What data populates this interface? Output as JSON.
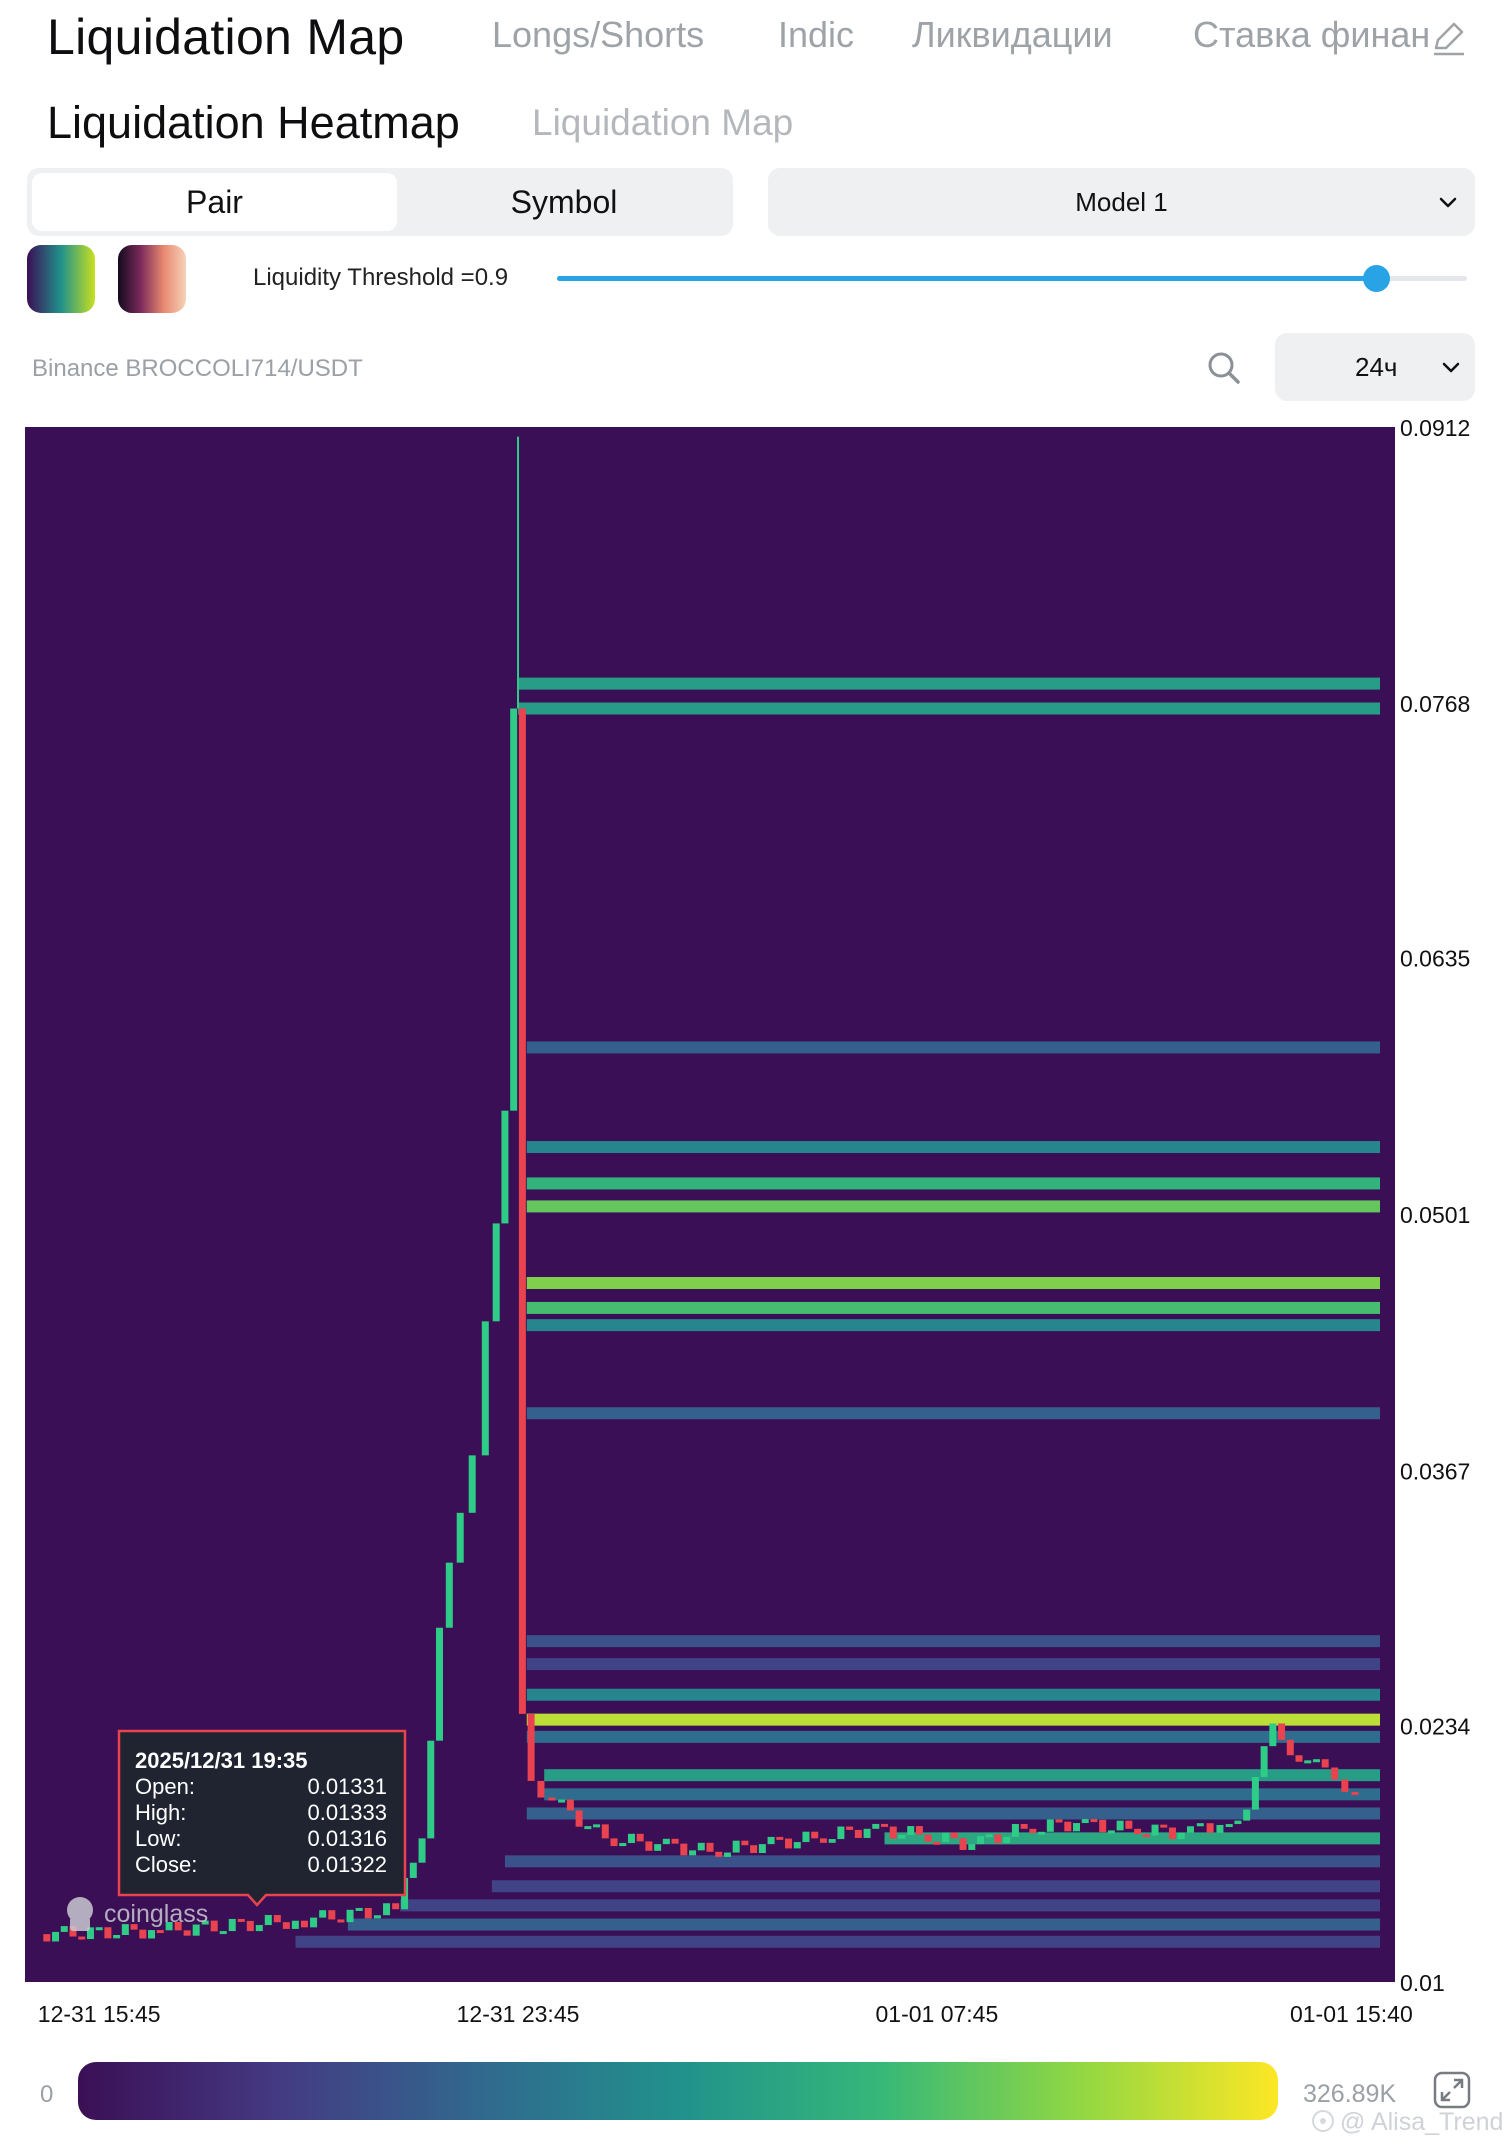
{
  "nav": {
    "title": "Liquidation Map",
    "tabs": [
      "Longs/Shorts",
      "Indic",
      "Ликвидации",
      "Ставка финан"
    ]
  },
  "sub": {
    "title": "Liquidation Heatmap",
    "tab": "Liquidation Map"
  },
  "segment": {
    "options": [
      "Pair",
      "Symbol"
    ],
    "active": "Pair"
  },
  "model": {
    "selected": "Model 1"
  },
  "threshold": {
    "label": "Liquidity Threshold =0.9",
    "value": 0.9
  },
  "pair_label": "Binance BROCCOLI714/USDT",
  "timeframe": {
    "selected": "24ч"
  },
  "tooltip": {
    "date": "2025/12/31 19:35",
    "rows": [
      {
        "label": "Open:",
        "value": "0.01331"
      },
      {
        "label": "High:",
        "value": "0.01333"
      },
      {
        "label": "Low:",
        "value": "0.01316"
      },
      {
        "label": "Close:",
        "value": "0.01322"
      }
    ]
  },
  "watermark": "coinglass",
  "legend": {
    "min": "0",
    "max": "326.89K"
  },
  "credit": "@ Alisa_Trend",
  "colors": {
    "background": "#3b0f55",
    "up": "#2ecc87",
    "down": "#e8434f",
    "accent": "#27a3e6"
  },
  "icons": [
    "edit-icon",
    "chevron-down-icon",
    "search-icon",
    "fullscreen-icon",
    "coinglass-logo-icon"
  ],
  "chart_data": {
    "type": "heatmap",
    "title": "",
    "xlabel": "",
    "ylabel": "",
    "ylim": [
      0.01,
      0.0912
    ],
    "xlim": [
      "12-31 14:20",
      "01-01 16:30"
    ],
    "y_ticks": [
      "0.0912",
      "0.0768",
      "0.0635",
      "0.0501",
      "0.0367",
      "0.0234",
      "0.01"
    ],
    "x_ticks": [
      {
        "label": "12-31 15:45",
        "t": "12-31 15:45"
      },
      {
        "label": "12-31 23:45",
        "t": "12-31 23:45"
      },
      {
        "label": "01-01 07:45",
        "t": "01-01 07:45"
      },
      {
        "label": "01-01 15:40",
        "t": "01-01 15:40"
      }
    ],
    "liquidation_bands": [
      {
        "price": 0.0778,
        "intensity": 0.55,
        "from": "12-31 23:45"
      },
      {
        "price": 0.0765,
        "intensity": 0.55,
        "from": "12-31 23:45"
      },
      {
        "price": 0.0588,
        "intensity": 0.3,
        "from": "12-31 23:55"
      },
      {
        "price": 0.0536,
        "intensity": 0.45,
        "from": "12-31 23:55"
      },
      {
        "price": 0.0517,
        "intensity": 0.65,
        "from": "12-31 23:55"
      },
      {
        "price": 0.0505,
        "intensity": 0.75,
        "from": "12-31 23:55"
      },
      {
        "price": 0.0465,
        "intensity": 0.8,
        "from": "12-31 23:55"
      },
      {
        "price": 0.0452,
        "intensity": 0.7,
        "from": "12-31 23:55"
      },
      {
        "price": 0.0443,
        "intensity": 0.45,
        "from": "12-31 23:55"
      },
      {
        "price": 0.0397,
        "intensity": 0.3,
        "from": "12-31 23:55"
      },
      {
        "price": 0.0278,
        "intensity": 0.25,
        "from": "12-31 23:55"
      },
      {
        "price": 0.0266,
        "intensity": 0.2,
        "from": "12-31 23:55"
      },
      {
        "price": 0.025,
        "intensity": 0.45,
        "from": "12-31 23:55"
      },
      {
        "price": 0.0237,
        "intensity": 0.9,
        "from": "12-31 23:55"
      },
      {
        "price": 0.0228,
        "intensity": 0.35,
        "from": "12-31 23:55"
      },
      {
        "price": 0.0208,
        "intensity": 0.55,
        "from": "01-01 00:15"
      },
      {
        "price": 0.0198,
        "intensity": 0.35,
        "from": "01-01 00:15"
      },
      {
        "price": 0.0188,
        "intensity": 0.3,
        "from": "12-31 23:55"
      },
      {
        "price": 0.0175,
        "intensity": 0.6,
        "from": "01-01 06:45"
      },
      {
        "price": 0.0163,
        "intensity": 0.25,
        "from": "12-31 23:30"
      },
      {
        "price": 0.015,
        "intensity": 0.2,
        "from": "12-31 23:15"
      },
      {
        "price": 0.014,
        "intensity": 0.2,
        "from": "12-31 21:30"
      },
      {
        "price": 0.013,
        "intensity": 0.3,
        "from": "12-31 20:30"
      },
      {
        "price": 0.0121,
        "intensity": 0.2,
        "from": "12-31 19:30"
      }
    ],
    "price_series": {
      "name": "",
      "x": [
        "12-31 14:40",
        "12-31 17:00",
        "12-31 19:35",
        "12-31 21:30",
        "12-31 22:00",
        "12-31 22:20",
        "12-31 22:45",
        "12-31 23:00",
        "12-31 23:15",
        "12-31 23:35",
        "12-31 23:45",
        "12-31 23:55",
        "01-01 00:05",
        "01-01 00:30",
        "01-01 01:30",
        "01-01 02:30",
        "01-01 03:30",
        "01-01 04:30",
        "01-01 05:30",
        "01-01 06:30",
        "01-01 07:30",
        "01-01 08:30",
        "01-01 09:30",
        "01-01 10:30",
        "01-01 11:30",
        "01-01 12:30",
        "01-01 13:15",
        "01-01 13:45",
        "01-01 14:15",
        "01-01 14:45",
        "01-01 15:15",
        "01-01 15:50"
      ],
      "close": [
        0.0125,
        0.0127,
        0.0132,
        0.0138,
        0.0175,
        0.0285,
        0.0345,
        0.0375,
        0.0445,
        0.0555,
        0.0765,
        0.024,
        0.0205,
        0.0195,
        0.0175,
        0.0172,
        0.0168,
        0.0172,
        0.0175,
        0.018,
        0.0177,
        0.0172,
        0.018,
        0.0183,
        0.018,
        0.0178,
        0.0182,
        0.019,
        0.0235,
        0.0215,
        0.0212,
        0.0198
      ]
    },
    "color_scale": {
      "min": 0,
      "max": 326890,
      "max_label": "326.89K"
    }
  }
}
